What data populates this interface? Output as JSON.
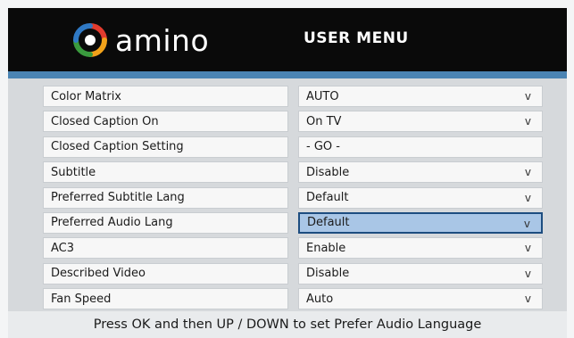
{
  "header": {
    "brand": "amino",
    "title": "USER MENU"
  },
  "menu": {
    "rows": [
      {
        "label": "Color Matrix",
        "value": "AUTO",
        "dropdown": true
      },
      {
        "label": "Closed Caption On",
        "value": "On TV",
        "dropdown": true
      },
      {
        "label": "Closed Caption Setting",
        "value": "- GO -",
        "dropdown": false
      },
      {
        "label": "Subtitle",
        "value": "Disable",
        "dropdown": true
      },
      {
        "label": "Preferred Subtitle Lang",
        "value": "Default",
        "dropdown": true
      },
      {
        "label": "Preferred Audio Lang",
        "value": "Default",
        "dropdown": true,
        "selected": true
      },
      {
        "label": "AC3",
        "value": "Enable",
        "dropdown": true
      },
      {
        "label": "Described Video",
        "value": "Disable",
        "dropdown": true
      },
      {
        "label": "Fan Speed",
        "value": "Auto",
        "dropdown": true
      }
    ],
    "dropdown_glyph": "v"
  },
  "footer": {
    "hint": "Press OK and then UP / DOWN to set Prefer Audio Language"
  },
  "colors": {
    "header_bg": "#0a0a0a",
    "accent": "#4b84b3",
    "selected_bg": "#a9c6e6",
    "selected_border": "#1d4d80"
  }
}
